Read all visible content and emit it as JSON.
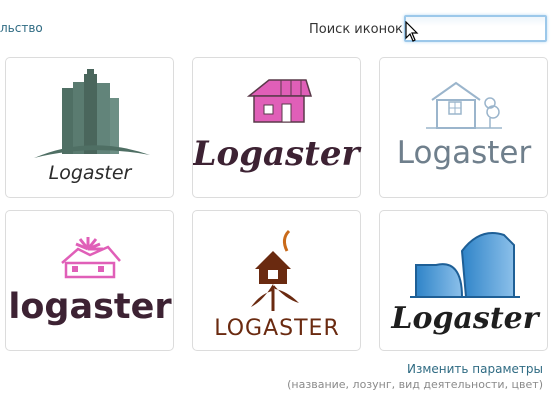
{
  "header": {
    "left_link": "льство",
    "search_label": "Поиск иконок:",
    "search_value": ""
  },
  "logos": [
    {
      "id": "logo-1",
      "text": "Logaster",
      "icon": "city-skyline-icon",
      "colors": {
        "primary": "#4f6f64",
        "text": "#2b2b2b"
      }
    },
    {
      "id": "logo-2",
      "text": "Logaster",
      "icon": "pink-house-icon",
      "colors": {
        "primary": "#e05fb8",
        "text": "#3d2233"
      }
    },
    {
      "id": "logo-3",
      "text": "Logaster",
      "icon": "outline-house-icon",
      "colors": {
        "primary": "#9bb5cc",
        "text": "#6f7f8c"
      }
    },
    {
      "id": "logo-4",
      "text": "logaster",
      "icon": "sun-house-icon",
      "colors": {
        "primary": "#e05fb8",
        "text": "#3d2233"
      }
    },
    {
      "id": "logo-5",
      "text": "LOGASTER",
      "icon": "house-flower-icon",
      "colors": {
        "primary": "#6a2a10",
        "text": "#6a2a10"
      }
    },
    {
      "id": "logo-6",
      "text": "Logaster",
      "icon": "blue-building-icon",
      "colors": {
        "primary": "#2f84c8",
        "text": "#1e1e1e"
      }
    }
  ],
  "footer": {
    "change_link": "Изменить параметры",
    "hint": "(название, лозунг, вид деятельности, цвет)"
  }
}
